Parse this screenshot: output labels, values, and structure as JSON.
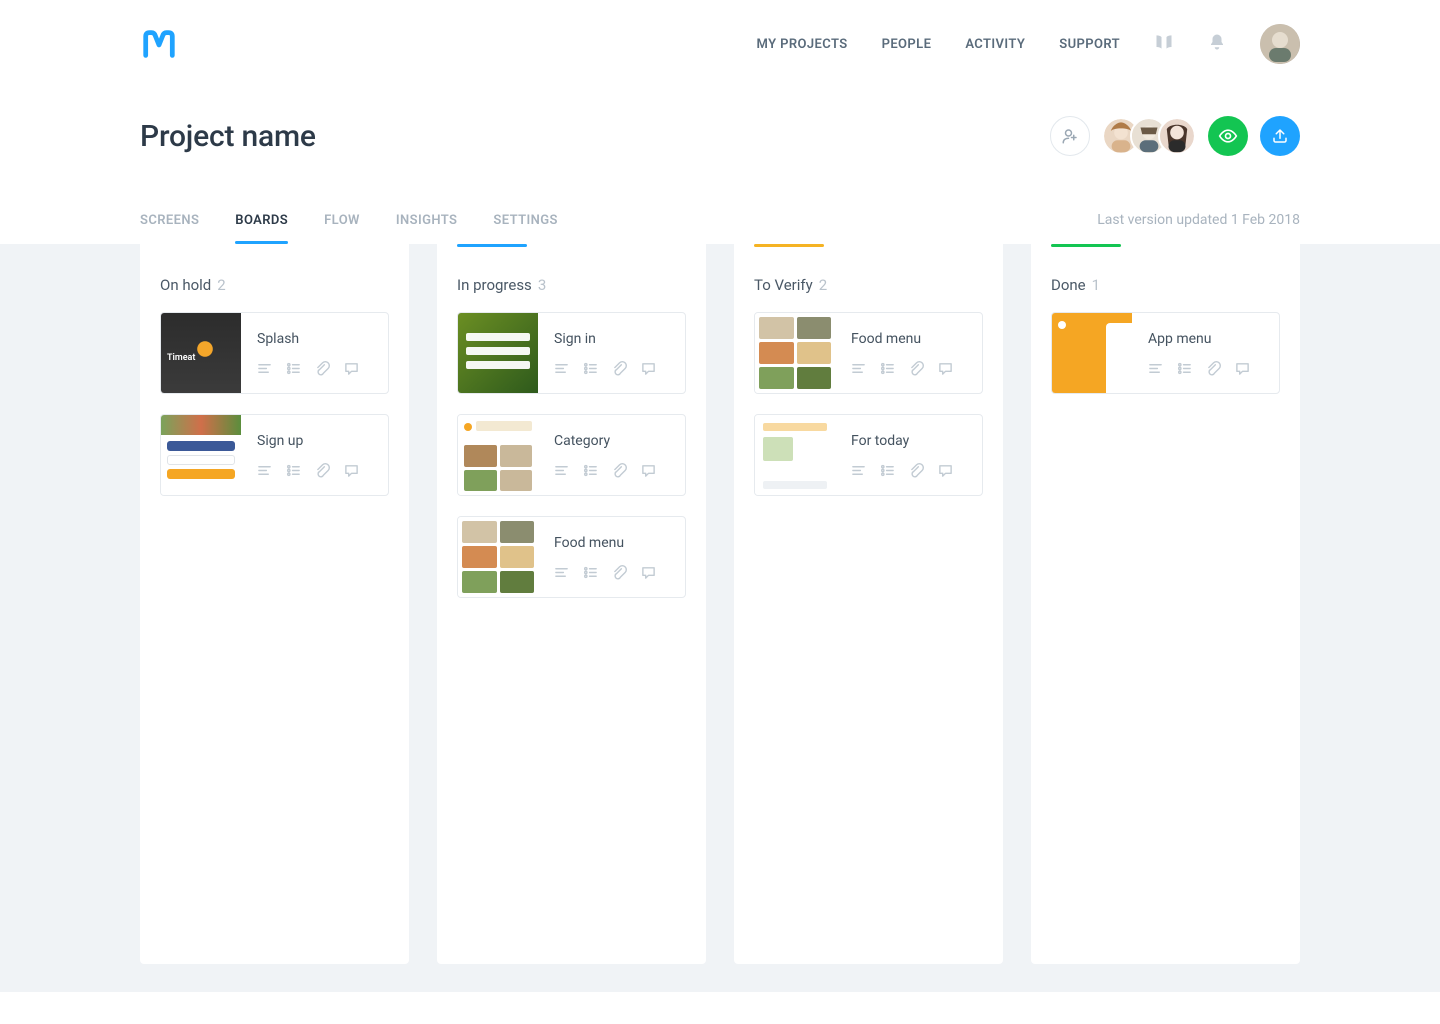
{
  "nav": {
    "links": [
      "MY PROJECTS",
      "PEOPLE",
      "ACTIVITY",
      "SUPPORT"
    ]
  },
  "page": {
    "title": "Project name",
    "version_text": "Last version updated 1 Feb 2018"
  },
  "tabs": [
    "SCREENS",
    "BOARDS",
    "FLOW",
    "INSIGHTS",
    "SETTINGS"
  ],
  "active_tab_index": 1,
  "columns": [
    {
      "title": "On hold",
      "count": "2",
      "accent": "#ff4d4d",
      "cards": [
        {
          "title": "Splash"
        },
        {
          "title": "Sign up"
        }
      ]
    },
    {
      "title": "In progress",
      "count": "3",
      "accent": "#1fa3ff",
      "cards": [
        {
          "title": "Sign in"
        },
        {
          "title": "Category"
        },
        {
          "title": "Food menu"
        }
      ]
    },
    {
      "title": "To Verify",
      "count": "2",
      "accent": "#f5b323",
      "cards": [
        {
          "title": "Food menu"
        },
        {
          "title": "For today"
        }
      ]
    },
    {
      "title": "Done",
      "count": "1",
      "accent": "#13c552",
      "cards": [
        {
          "title": "App menu"
        }
      ]
    }
  ],
  "collaborators": 3
}
